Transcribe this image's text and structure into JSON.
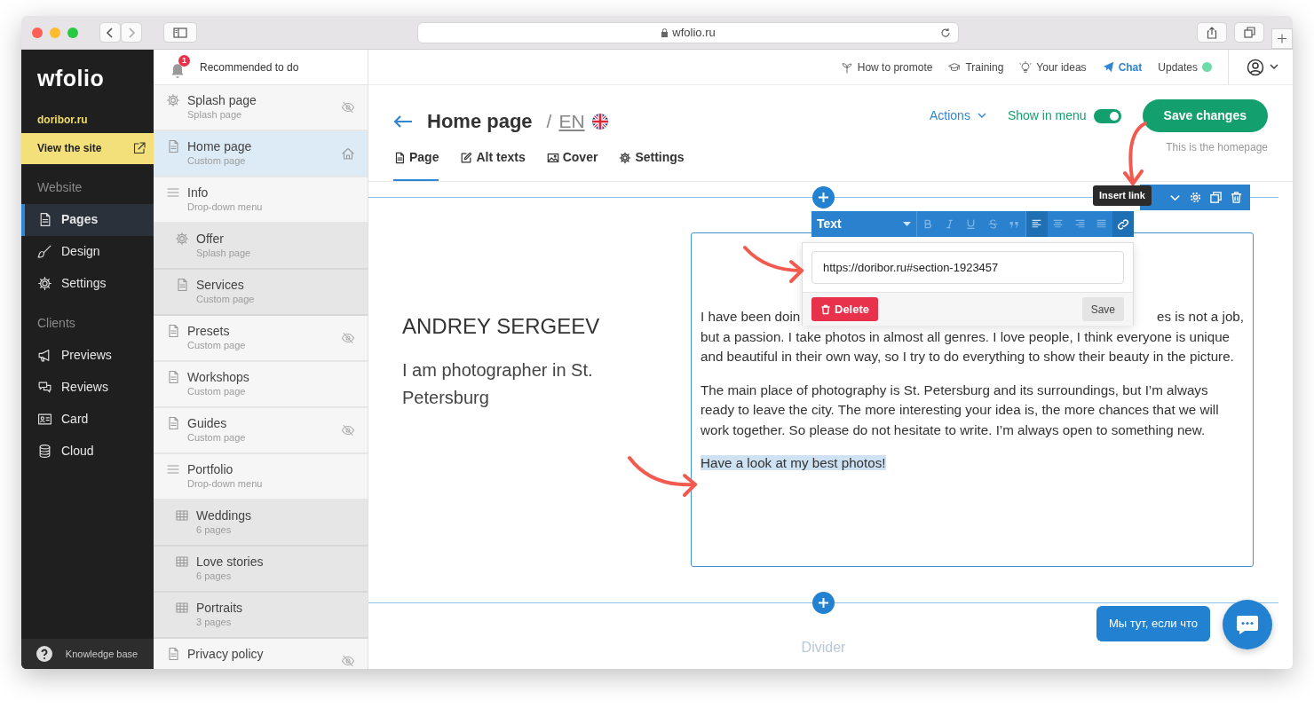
{
  "browser": {
    "url": "wfolio.ru"
  },
  "sidebar": {
    "logo": "wfolio",
    "site": "doribor.ru",
    "view_site": "View the site",
    "sections": [
      {
        "title": "Website",
        "items": [
          {
            "label": "Pages",
            "selected": true
          },
          {
            "label": "Design",
            "selected": false
          },
          {
            "label": "Settings",
            "selected": false
          }
        ]
      },
      {
        "title": "Clients",
        "items": [
          {
            "label": "Previews",
            "selected": false
          },
          {
            "label": "Reviews",
            "selected": false
          },
          {
            "label": "Card",
            "selected": false
          },
          {
            "label": "Cloud",
            "selected": false
          }
        ]
      }
    ],
    "help": "Knowledge base"
  },
  "topbar": {
    "notifications": "1",
    "recommended": "Recommended to do",
    "links": [
      {
        "label": "How to promote",
        "highlighted": false
      },
      {
        "label": "Training",
        "highlighted": false
      },
      {
        "label": "Your ideas",
        "highlighted": false
      },
      {
        "label": "Chat",
        "highlighted": true
      },
      {
        "label": "Updates",
        "highlighted": false
      }
    ]
  },
  "pages": [
    {
      "title": "Splash page",
      "subtitle": "Splash page",
      "kind": "splash",
      "hidden": true,
      "home": false,
      "selected": false
    },
    {
      "title": "Home page",
      "subtitle": "Custom page",
      "kind": "custom",
      "hidden": false,
      "home": true,
      "selected": true
    },
    {
      "title": "Info",
      "subtitle": "Drop-down menu",
      "kind": "dropdown",
      "hidden": false,
      "home": false,
      "selected": false,
      "children": [
        {
          "title": "Offer",
          "subtitle": "Splash page",
          "kind": "splash",
          "hidden": false,
          "home": false,
          "selected": false
        },
        {
          "title": "Services",
          "subtitle": "Custom page",
          "kind": "custom",
          "hidden": false,
          "home": false,
          "selected": false
        }
      ]
    },
    {
      "title": "Presets",
      "subtitle": "Custom page",
      "kind": "custom",
      "hidden": true,
      "home": false,
      "selected": false
    },
    {
      "title": "Workshops",
      "subtitle": "Custom page",
      "kind": "custom",
      "hidden": false,
      "home": false,
      "selected": false
    },
    {
      "title": "Guides",
      "subtitle": "Custom page",
      "kind": "custom",
      "hidden": true,
      "home": false,
      "selected": false
    },
    {
      "title": "Portfolio",
      "subtitle": "Drop-down menu",
      "kind": "dropdown",
      "hidden": false,
      "home": false,
      "selected": false,
      "children": [
        {
          "title": "Weddings",
          "subtitle": "6 pages",
          "kind": "gallery",
          "hidden": false,
          "home": false,
          "selected": false
        },
        {
          "title": "Love stories",
          "subtitle": "6 pages",
          "kind": "gallery",
          "hidden": false,
          "home": false,
          "selected": false
        },
        {
          "title": "Portraits",
          "subtitle": "3 pages",
          "kind": "gallery",
          "hidden": false,
          "home": false,
          "selected": false
        }
      ]
    },
    {
      "title": "Privacy policy",
      "kind": "custom",
      "hidden": true,
      "home": false,
      "selected": false
    }
  ],
  "header": {
    "title": "Home page",
    "separator": "/",
    "language": "EN",
    "actions": "Actions",
    "show_in_menu": {
      "label": "Show in menu",
      "on": true
    },
    "save": "Save changes",
    "note": "This is the homepage",
    "tabs": [
      {
        "label": "Page",
        "selected": true
      },
      {
        "label": "Alt texts",
        "selected": false
      },
      {
        "label": "Cover",
        "selected": false
      },
      {
        "label": "Settings",
        "selected": false
      }
    ]
  },
  "editor": {
    "toolbar": {
      "style": "Text",
      "tooltip": "Insert link"
    },
    "link_popup": {
      "url": "https://doribor.ru#section-1923457",
      "delete": "Delete",
      "save": "Save"
    },
    "name": "ANDREY SERGEEV",
    "tagline": "I am photographer in St. Petersburg",
    "first_line_start": "I have been doin",
    "first_line_end": "es is not a job,",
    "paragraphs": [
      "but a passion. I take photos in almost all genres. I love people, I think everyone is unique and beautiful in their own way, so I try to do everything to show their beauty in the picture.",
      "The main place of photography is St. Petersburg and its surroundings, but I’m always ready to leave the city. The more interesting your idea is, the more chances that we will work together. So please do not hesitate to write. I’m always open to something new."
    ],
    "highlight": {
      "text": "Have a look at my best photos!",
      "selected": true
    },
    "divider": "Divider"
  },
  "chat": {
    "bubble": "Мы тут, если что"
  }
}
